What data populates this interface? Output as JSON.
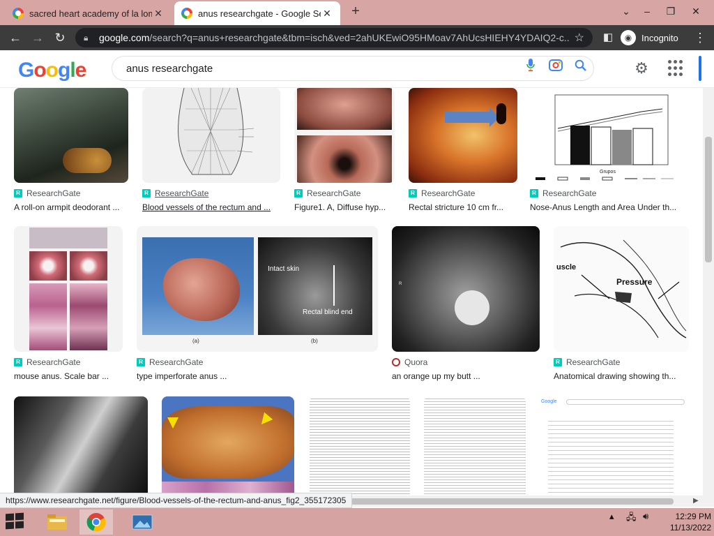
{
  "browser": {
    "tabs": [
      {
        "title": "sacred heart academy of la loma",
        "active": false
      },
      {
        "title": "anus researchgate - Google Sear",
        "active": true
      }
    ],
    "url_host": "google.com",
    "url_rest": "/search?q=anus+researchgate&tbm=isch&ved=2ahUKEwiO95HMoav7AhUcsHIEHY4YDAIQ2-c...",
    "profile_label": "Incognito",
    "status_url": "https://www.researchgate.net/figure/Blood-vessels-of-the-rectum-and-anus_fig2_355172305"
  },
  "google": {
    "logo": "Google",
    "query": "anus researchgate"
  },
  "results": [
    {
      "source": "ResearchGate",
      "caption": "A roll-on armpit deodorant ..."
    },
    {
      "source": "ResearchGate",
      "caption": "Blood vessels of the rectum and ..."
    },
    {
      "source": "ResearchGate",
      "caption": "Figure1. A, Diffuse hyp..."
    },
    {
      "source": "ResearchGate",
      "caption": "Rectal stricture 10 cm fr..."
    },
    {
      "source": "ResearchGate",
      "caption": "Nose-Anus Length and Area Under th..."
    },
    {
      "source": "ResearchGate",
      "caption": "mouse anus. Scale bar ..."
    },
    {
      "source": "ResearchGate",
      "caption": "type imperforate anus ..."
    },
    {
      "source": "Quora",
      "caption": "an orange up my butt ..."
    },
    {
      "source": "ResearchGate",
      "caption": "Anatomical drawing showing th..."
    }
  ],
  "image_labels": {
    "intact_skin": "Intact skin",
    "rectal_blind_end": "Rectal blind end",
    "a": "(a)",
    "b": "(b)",
    "pressure": "Pressure",
    "muscle": "uscle",
    "grupos": "Grupos",
    "google_small": "Google"
  },
  "taskbar": {
    "time": "12:29 PM",
    "date": "11/13/2022"
  },
  "colors": {
    "tabstrip": "#d7a5a3",
    "toolbar": "#3c3c3c",
    "accent": "#1a73e8",
    "researchgate": "#00ccbb",
    "quora": "#b92b27"
  }
}
